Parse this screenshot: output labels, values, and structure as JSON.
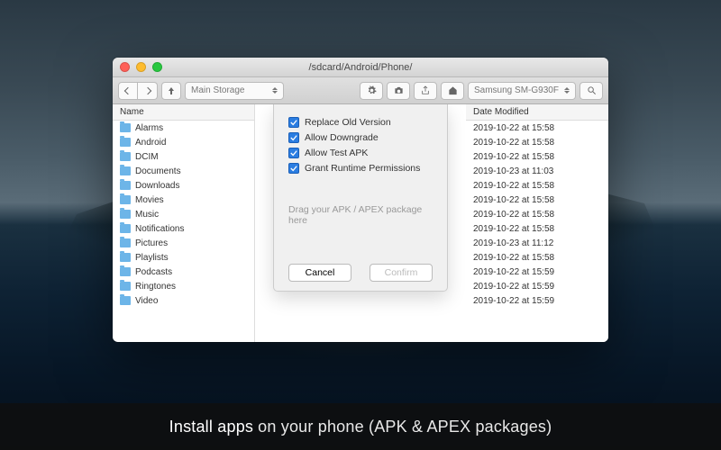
{
  "window": {
    "title": "/sdcard/Android/Phone/",
    "storage_selector": "Main Storage",
    "device_selector": "Samsung SM-G930F"
  },
  "columns": {
    "name_header": "Name",
    "date_header": "Date Modified"
  },
  "files": [
    {
      "name": "Alarms",
      "date": "2019-10-22 at 15:58"
    },
    {
      "name": "Android",
      "date": "2019-10-22 at 15:58"
    },
    {
      "name": "DCIM",
      "date": "2019-10-22 at 15:58"
    },
    {
      "name": "Documents",
      "date": "2019-10-23 at 11:03"
    },
    {
      "name": "Downloads",
      "date": "2019-10-22 at 15:58"
    },
    {
      "name": "Movies",
      "date": "2019-10-22 at 15:58"
    },
    {
      "name": "Music",
      "date": "2019-10-22 at 15:58"
    },
    {
      "name": "Notifications",
      "date": "2019-10-22 at 15:58"
    },
    {
      "name": "Pictures",
      "date": "2019-10-23 at 11:12"
    },
    {
      "name": "Playlists",
      "date": "2019-10-22 at 15:58"
    },
    {
      "name": "Podcasts",
      "date": "2019-10-22 at 15:59"
    },
    {
      "name": "Ringtones",
      "date": "2019-10-22 at 15:59"
    },
    {
      "name": "Video",
      "date": "2019-10-22 at 15:59"
    }
  ],
  "sheet": {
    "options": [
      {
        "label": "Replace Old Version",
        "checked": true
      },
      {
        "label": "Allow Downgrade",
        "checked": true
      },
      {
        "label": "Allow Test APK",
        "checked": true
      },
      {
        "label": "Grant Runtime Permissions",
        "checked": true
      }
    ],
    "drop_hint": "Drag your APK / APEX package here",
    "cancel": "Cancel",
    "confirm": "Confirm"
  },
  "caption": {
    "bold": "Install apps",
    "rest": "on your phone (APK & APEX packages)"
  }
}
